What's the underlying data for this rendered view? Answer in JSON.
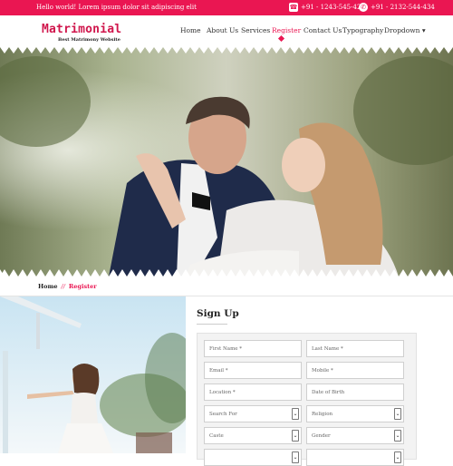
{
  "topbar": {
    "hello": "Hello world! Lorem ipsum dolor sit adipiscing elit",
    "phone": "+91 - 1243-545-423",
    "whatsapp": "+91 - 2132-544-434"
  },
  "brand": {
    "title": "Matrimonial",
    "tagline": "Best Matrimony Website"
  },
  "nav": {
    "items": [
      "Home",
      "About Us",
      "Services",
      "Register",
      "Contact Us",
      "Typography",
      "Dropdown"
    ],
    "active": "Register",
    "dropdown_caret": "▾"
  },
  "breadcrumb": {
    "home": "Home",
    "separator": "//",
    "current": "Register"
  },
  "form": {
    "title": "Sign Up",
    "fields": [
      {
        "placeholder": "First Name *",
        "type": "text"
      },
      {
        "placeholder": "Last Name *",
        "type": "text"
      },
      {
        "placeholder": "Email *",
        "type": "text"
      },
      {
        "placeholder": "Mobile *",
        "type": "text"
      },
      {
        "placeholder": "Location *",
        "type": "text"
      },
      {
        "placeholder": "Date of Birth",
        "type": "text"
      },
      {
        "placeholder": "Search For",
        "type": "select"
      },
      {
        "placeholder": "Religion",
        "type": "select"
      },
      {
        "placeholder": "Caste",
        "type": "select"
      },
      {
        "placeholder": "Gender",
        "type": "select"
      }
    ]
  },
  "colors": {
    "accent": "#ea1652",
    "brand": "#d0164c"
  },
  "icons": {
    "phone": "phone-icon",
    "whatsapp": "whatsapp-icon",
    "select_chevron": "chevron-down-icon"
  }
}
